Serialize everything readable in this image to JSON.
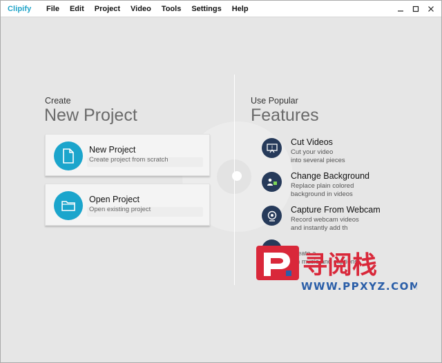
{
  "app": {
    "logo": "Clipify",
    "menu": [
      "File",
      "Edit",
      "Project",
      "Video",
      "Tools",
      "Settings",
      "Help"
    ],
    "window_controls": {
      "minimize": "—",
      "maximize": "☐",
      "close": "✕"
    }
  },
  "create": {
    "subtitle": "Create",
    "title": "New Project",
    "cards": [
      {
        "title": "New Project",
        "desc": "Create project from scratch",
        "icon": "document-icon"
      },
      {
        "title": "Open Project",
        "desc": "Open existing project",
        "icon": "folder-icon"
      }
    ]
  },
  "features": {
    "subtitle": "Use Popular",
    "title": "Features",
    "items": [
      {
        "title": "Cut Videos",
        "desc_line1": "Cut your video",
        "desc_line2": "into several pieces",
        "icon": "cut-video-icon"
      },
      {
        "title": "Change Background",
        "desc_line1": "Replace plain colored",
        "desc_line2": "background in videos",
        "icon": "change-background-icon"
      },
      {
        "title": "Capture From Webcam",
        "desc_line1": "Record webcam videos",
        "desc_line2": "and instantly add th",
        "icon": "webcam-icon"
      },
      {
        "title": "",
        "desc_line1": "Create a ...",
        "desc_line2": "...h music and captions",
        "icon": "slideshow-icon"
      }
    ]
  },
  "watermark": {
    "chinese": "寻阅栈",
    "url": "WWW.PPXYZ.COM",
    "colors": {
      "red": "#d9283a",
      "blue": "#2a5ea8"
    }
  },
  "colors": {
    "accent": "#1ba5cc",
    "feature_icon_bg": "#263a5a"
  }
}
